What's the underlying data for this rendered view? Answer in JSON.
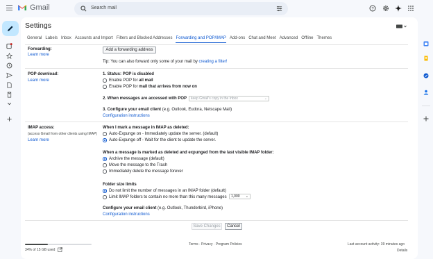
{
  "topbar": {
    "brand": "Gmail",
    "search_placeholder": "Search mail"
  },
  "settings": {
    "title": "Settings",
    "tabs": [
      "General",
      "Labels",
      "Inbox",
      "Accounts and Import",
      "Filters and Blocked Addresses",
      "Forwarding and POP/IMAP",
      "Add-ons",
      "Chat and Meet",
      "Advanced",
      "Offline",
      "Themes"
    ],
    "active_tab_index": 5
  },
  "forwarding": {
    "label": "Forwarding:",
    "learn_more": "Learn more",
    "add_button": "Add a forwarding address",
    "tip": "Tip: You can also forward only some of your mail by ",
    "tip_link": "creating a filter!"
  },
  "pop": {
    "label": "POP download:",
    "learn_more": "Learn more",
    "status_prefix": "1. Status: ",
    "status": "POP is disabled",
    "option_all_prefix": "Enable POP for ",
    "option_all_bold": "all mail",
    "option_now_prefix": "Enable POP for ",
    "option_now_bold": "mail that arrives from now on",
    "step2": "2. When messages are accessed with POP",
    "step2_select": "keep Gmail's copy in the Inbox",
    "step3_bold": "3. Configure your email client",
    "step3_rest": " (e.g. Outlook, Eudora, Netscape Mail)",
    "config_link": "Configuration instructions"
  },
  "imap": {
    "label": "IMAP access:",
    "sub": "(access Gmail from other clients using IMAP)",
    "learn_more": "Learn more",
    "deleted_title": "When I mark a message in IMAP as deleted:",
    "auto_on": "Auto-Expunge on - Immediately update the server. (default)",
    "auto_off": "Auto-Expunge off - Wait for the client to update the server.",
    "expunged_title": "When a message is marked as deleted and expunged from the last visible IMAP folder:",
    "archive": "Archive the message (default)",
    "trash": "Move the message to the Trash",
    "delete_forever": "Immediately delete the message forever",
    "folder_title": "Folder size limits",
    "no_limit": "Do not limit the number of messages in an IMAP folder (default)",
    "limit": "Limit IMAP folders to contain no more than this many messages",
    "limit_value": "1,000",
    "configure_bold": "Configure your email client",
    "configure_rest": " (e.g. Outlook, Thunderbird, iPhone)",
    "config_link": "Configuration instructions"
  },
  "actions": {
    "save": "Save Changes",
    "cancel": "Cancel"
  },
  "footer": {
    "storage": "34% of 15 GB used",
    "storage_fraction": 0.34,
    "links": "Terms · Privacy · Program Policies",
    "activity": "Last account activity: 39 minutes ago",
    "details": "Details"
  },
  "colors": {
    "accent": "#0b57d0",
    "compose_bg": "#c2e7ff",
    "page_bg": "#f6f8fc"
  },
  "icons": [
    "menu-icon",
    "gmail-logo-icon",
    "search-icon",
    "filter-icon",
    "help-icon",
    "settings-gear-icon",
    "gemini-icon",
    "apps-grid-icon",
    "avatar",
    "pencil-icon",
    "inbox-icon",
    "star-icon",
    "clock-icon",
    "send-icon",
    "file-icon",
    "mail-icon",
    "chevron-down-icon",
    "plus-icon",
    "calendar-icon",
    "keep-icon",
    "tasks-icon",
    "contacts-icon",
    "external-link-icon",
    "keyboard-icon"
  ]
}
